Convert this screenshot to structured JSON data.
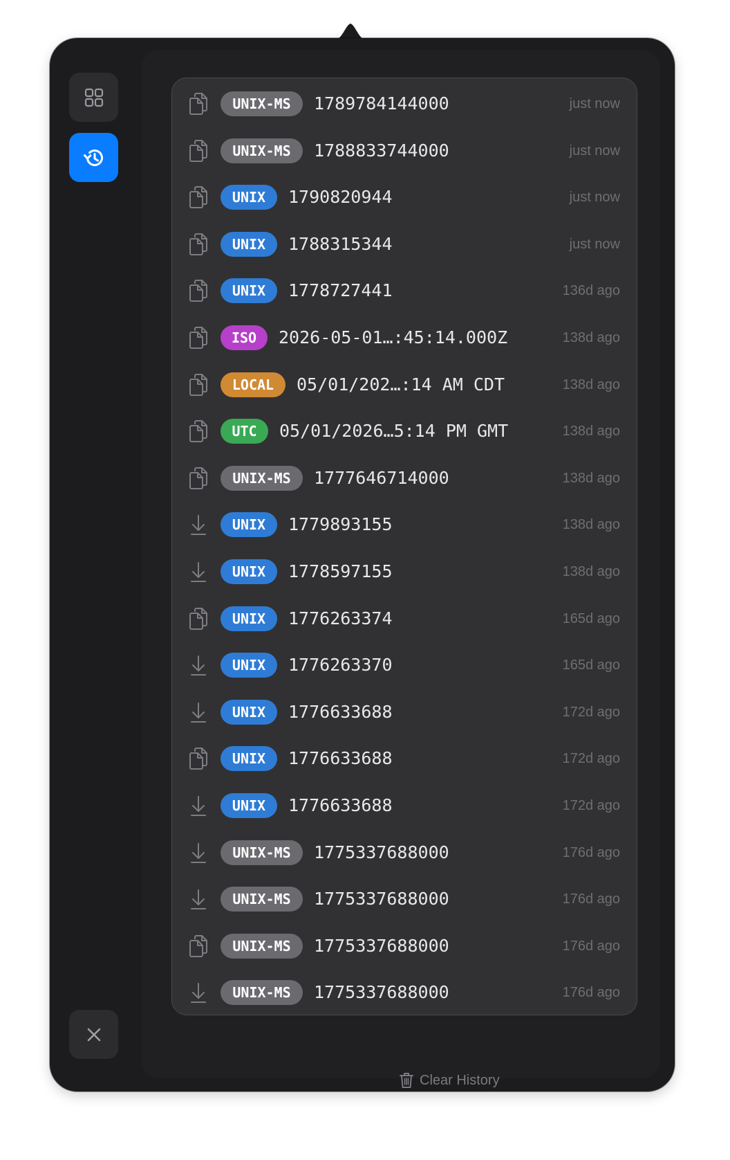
{
  "sidebar": {
    "grid_icon": "grid-icon",
    "history_icon": "history-icon",
    "close_icon": "close-icon"
  },
  "colors": {
    "accent": "#0a7cff",
    "badge_unix_ms": "#6b6b6f",
    "badge_unix": "#2f7cd6",
    "badge_iso": "#b640c9",
    "badge_local": "#d08a33",
    "badge_utc": "#3aa955"
  },
  "history": [
    {
      "action": "copy",
      "format": "UNIX-MS",
      "value": "1789784144000",
      "time": "just now"
    },
    {
      "action": "copy",
      "format": "UNIX-MS",
      "value": "1788833744000",
      "time": "just now"
    },
    {
      "action": "copy",
      "format": "UNIX",
      "value": "1790820944",
      "time": "just now"
    },
    {
      "action": "copy",
      "format": "UNIX",
      "value": "1788315344",
      "time": "just now"
    },
    {
      "action": "copy",
      "format": "UNIX",
      "value": "1778727441",
      "time": "136d ago"
    },
    {
      "action": "copy",
      "format": "ISO",
      "value": "2026-05-01…:45:14.000Z",
      "time": "138d ago"
    },
    {
      "action": "copy",
      "format": "LOCAL",
      "value": "05/01/202…:14 AM CDT",
      "time": "138d ago"
    },
    {
      "action": "copy",
      "format": "UTC",
      "value": "05/01/2026…5:14 PM GMT",
      "time": "138d ago"
    },
    {
      "action": "copy",
      "format": "UNIX-MS",
      "value": "1777646714000",
      "time": "138d ago"
    },
    {
      "action": "download",
      "format": "UNIX",
      "value": "1779893155",
      "time": "138d ago"
    },
    {
      "action": "download",
      "format": "UNIX",
      "value": "1778597155",
      "time": "138d ago"
    },
    {
      "action": "copy",
      "format": "UNIX",
      "value": "1776263374",
      "time": "165d ago"
    },
    {
      "action": "download",
      "format": "UNIX",
      "value": "1776263370",
      "time": "165d ago"
    },
    {
      "action": "download",
      "format": "UNIX",
      "value": "1776633688",
      "time": "172d ago"
    },
    {
      "action": "copy",
      "format": "UNIX",
      "value": "1776633688",
      "time": "172d ago"
    },
    {
      "action": "download",
      "format": "UNIX",
      "value": "1776633688",
      "time": "172d ago"
    },
    {
      "action": "download",
      "format": "UNIX-MS",
      "value": "1775337688000",
      "time": "176d ago"
    },
    {
      "action": "download",
      "format": "UNIX-MS",
      "value": "1775337688000",
      "time": "176d ago"
    },
    {
      "action": "copy",
      "format": "UNIX-MS",
      "value": "1775337688000",
      "time": "176d ago"
    },
    {
      "action": "download",
      "format": "UNIX-MS",
      "value": "1775337688000",
      "time": "176d ago"
    }
  ],
  "footer": {
    "clear_label": "Clear History",
    "trash_icon": "trash-icon"
  }
}
